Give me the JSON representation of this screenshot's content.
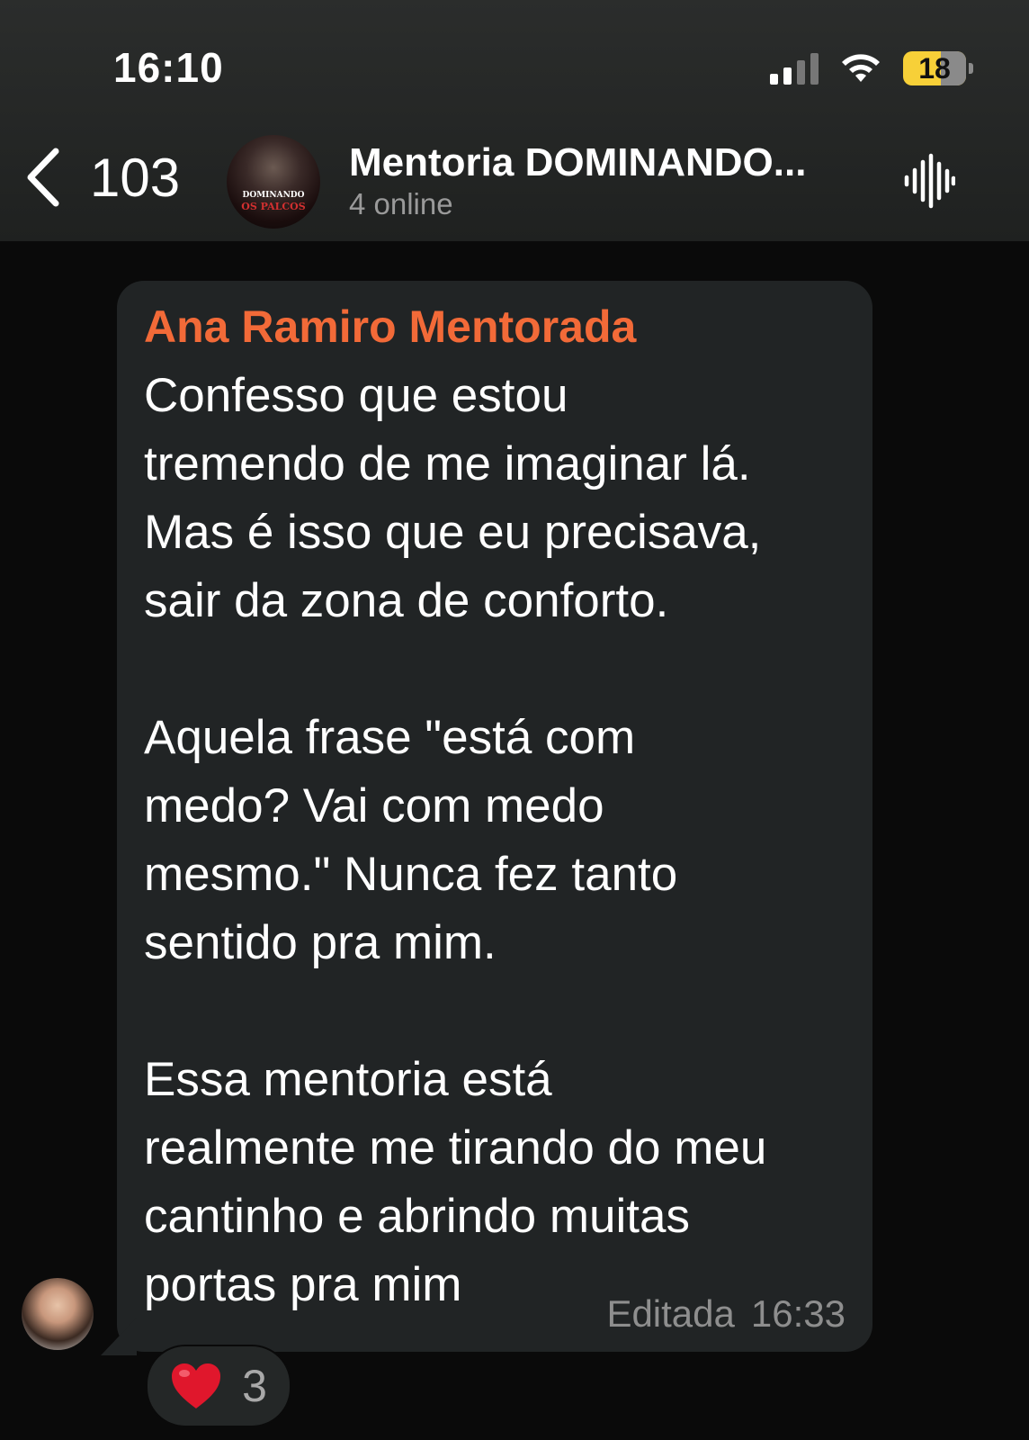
{
  "status_bar": {
    "time": "16:10",
    "battery": "18"
  },
  "header": {
    "back_count": "103",
    "avatar_text_1": "DOMINANDO",
    "avatar_text_2": "OS PALCOS",
    "title": "Mentoria DOMINANDO...",
    "subtitle": "4 online"
  },
  "message": {
    "sender": "Ana Ramiro Mentorada",
    "text": "Confesso que estou\ntremendo de me imaginar lá.\nMas é isso que eu precisava,\nsair da zona de conforto.\n\nAquela frase \"está com\nmedo? Vai com medo\nmesmo.\" Nunca fez tanto\nsentido pra mim.\n\nEssa mentoria está\nrealmente me tirando do meu\ncantinho e abrindo muitas\nportas pra mim",
    "edited_label": "Editada",
    "time": "16:33",
    "reaction_emoji": "heart-icon",
    "reaction_count": "3",
    "sender_color": "#f26a38"
  },
  "colors": {
    "bubble": "#212425",
    "background": "#0a0a0a",
    "battery_accent": "#f7d038"
  }
}
